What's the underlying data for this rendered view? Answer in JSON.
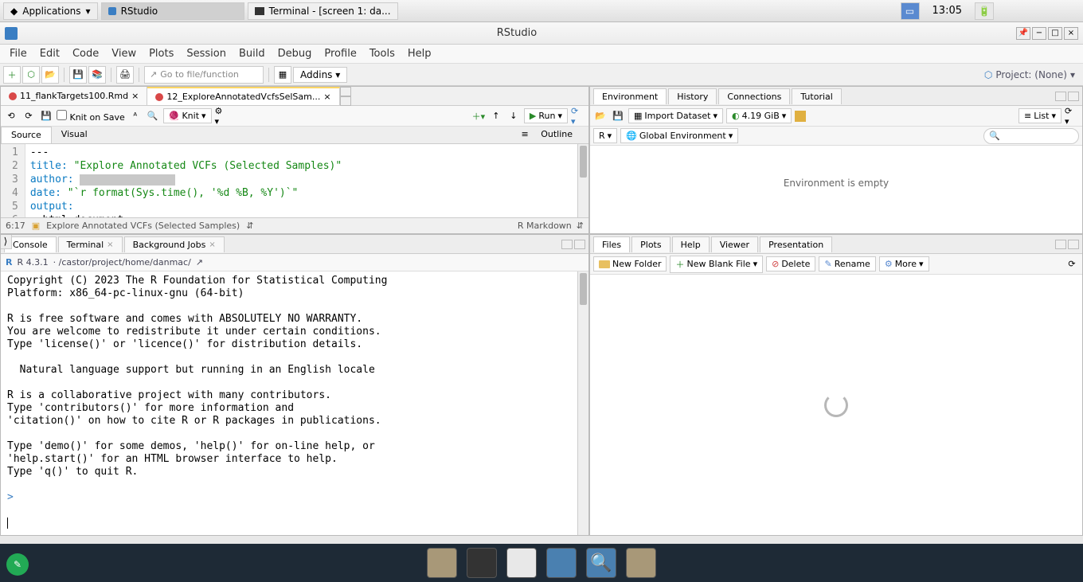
{
  "os": {
    "apps_label": "Applications",
    "task1": "RStudio",
    "task2": "Terminal - [screen 1: da...",
    "clock": "13:05"
  },
  "window": {
    "title": "RStudio"
  },
  "menu": {
    "items": [
      "File",
      "Edit",
      "Code",
      "View",
      "Plots",
      "Session",
      "Build",
      "Debug",
      "Profile",
      "Tools",
      "Help"
    ]
  },
  "toolbar": {
    "goto_placeholder": "Go to file/function",
    "addins": "Addins",
    "project": "Project: (None)"
  },
  "source": {
    "tab1": "11_flankTargets100.Rmd",
    "tab2": "12_ExploreAnnotatedVcfsSelSam...",
    "knit_on_save": "Knit on Save",
    "knit": "Knit",
    "run": "Run",
    "views": {
      "source": "Source",
      "visual": "Visual"
    },
    "outline": "Outline",
    "lines": {
      "l1": "---",
      "l2_key": "title:",
      "l2_val": "\"Explore Annotated VCFs (Selected Samples)\"",
      "l3_key": "author:",
      "l4_key": "date:",
      "l4_val": "\"`r format(Sys.time(), '%d %B, %Y')`\"",
      "l5_key": "output:",
      "l6": "  html_document:"
    },
    "status_pos": "6:17",
    "status_chunk": "Explore Annotated VCFs (Selected Samples)",
    "status_type": "R Markdown"
  },
  "console": {
    "tabs": [
      "Console",
      "Terminal",
      "Background Jobs"
    ],
    "version": "R 4.3.1",
    "path": "· /castor/project/home/danmac/",
    "body": "Copyright (C) 2023 The R Foundation for Statistical Computing\nPlatform: x86_64-pc-linux-gnu (64-bit)\n\nR is free software and comes with ABSOLUTELY NO WARRANTY.\nYou are welcome to redistribute it under certain conditions.\nType 'license()' or 'licence()' for distribution details.\n\n  Natural language support but running in an English locale\n\nR is a collaborative project with many contributors.\nType 'contributors()' for more information and\n'citation()' on how to cite R or R packages in publications.\n\nType 'demo()' for some demos, 'help()' for on-line help, or\n'help.start()' for an HTML browser interface to help.\nType 'q()' to quit R.\n",
    "prompt": ">"
  },
  "env": {
    "tabs": [
      "Environment",
      "History",
      "Connections",
      "Tutorial"
    ],
    "import": "Import Dataset",
    "mem": "4.19 GiB",
    "list": "List",
    "scope_r": "R",
    "scope_env": "Global Environment",
    "empty": "Environment is empty"
  },
  "files": {
    "tabs": [
      "Files",
      "Plots",
      "Help",
      "Viewer",
      "Presentation"
    ],
    "new_folder": "New Folder",
    "new_file": "New Blank File",
    "delete": "Delete",
    "rename": "Rename",
    "more": "More"
  }
}
